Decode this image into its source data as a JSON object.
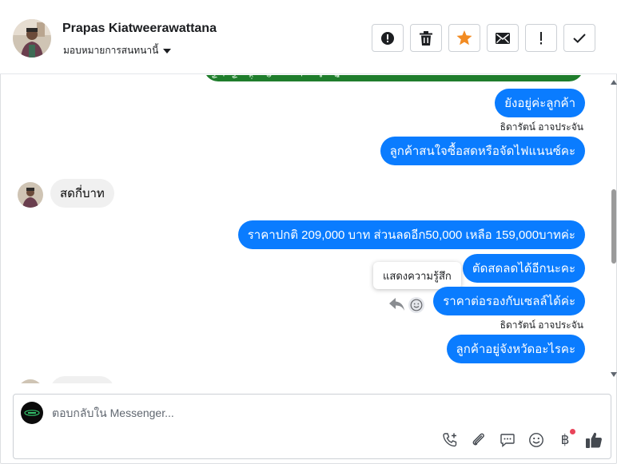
{
  "header": {
    "contact_name": "Prapas Kiatweerawattana",
    "assign_label": "มอบหมายการสนทนานี้",
    "toolbar": [
      {
        "name": "spam-button",
        "icon": "alert-circle-icon"
      },
      {
        "name": "delete-button",
        "icon": "trash-icon"
      },
      {
        "name": "star-button",
        "icon": "star-icon",
        "color": "#f28b22"
      },
      {
        "name": "mark-unread-button",
        "icon": "envelope-icon"
      },
      {
        "name": "follow-up-button",
        "icon": "exclamation-icon"
      },
      {
        "name": "mark-done-button",
        "icon": "check-icon"
      }
    ]
  },
  "messages": [
    {
      "direction": "outgoing",
      "text": "ยังอยู่ค่ะลูกค้า"
    },
    {
      "direction": "outgoing",
      "text": "ลูกค้าสนใจซื้อสดหรือจัดไฟแนนซ์คะ",
      "sender": "ธิดารัตน์ อาจประจัน"
    },
    {
      "direction": "incoming",
      "text": "สดกี่บาท"
    },
    {
      "direction": "outgoing",
      "text": "ราคาปกติ 209,000 บาท ส่วนลดอีก50,000 เหลือ 159,000บาทค่ะ"
    },
    {
      "direction": "outgoing",
      "text": "ตัดสดลดได้อีกนะคะ"
    },
    {
      "direction": "outgoing",
      "text": "ราคาต่อรองกับเซลล์ได้ค่ะ"
    },
    {
      "direction": "outgoing",
      "text": "ลูกค้าอยู่จังหวัดอะไรคะ",
      "sender": "ธิดารัตน์ อาจประจัน"
    }
  ],
  "tooltip": "แสดงความรู้สึก",
  "composer": {
    "placeholder": "ตอบกลับใน Messenger...",
    "tools": [
      "call-plus-icon",
      "paperclip-icon",
      "chat-bubble-icon",
      "smiley-icon",
      "baht-icon",
      "thumbs-up-icon"
    ],
    "baht_symbol": "฿"
  },
  "colors": {
    "outgoing_bubble": "#0a7cff",
    "incoming_bubble": "#f0f0f0",
    "star": "#f28b22",
    "notification_dot": "#e9445a"
  }
}
